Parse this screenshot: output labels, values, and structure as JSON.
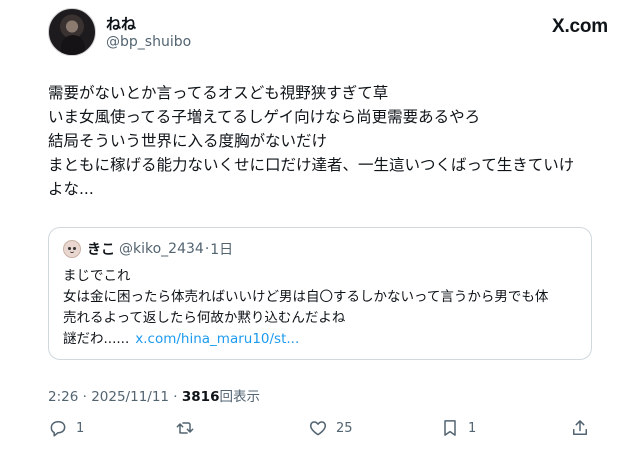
{
  "author": {
    "display_name": "ねね",
    "handle": "@bp_shuibo"
  },
  "brand": {
    "logo_text": "X.com"
  },
  "tweet": {
    "lines": [
      "需要がないとか言ってるオスども視野狭すぎて草",
      "いま女風使ってる子増えてるしゲイ向けなら尚更需要あるやろ",
      "結局そういう世界に入る度胸がないだけ",
      "まともに稼げる能力ないくせに口だけ達者、一生這いつくばって生きていけ",
      "よな..."
    ]
  },
  "quoted": {
    "name": "きこ",
    "handle": "@kiko_2434",
    "separator": "·",
    "time": "1日",
    "lines": [
      "まじでこれ",
      "女は金に困ったら体売ればいいけど男は自〇するしかないって言うから男でも体",
      "売れるよって返したら何故か黙り込むんだよね"
    ],
    "last_line": "謎だわ......",
    "link": "x.com/hina_maru10/st..."
  },
  "meta": {
    "time": "2:26",
    "dot": " · ",
    "date": "2025/11/11",
    "views_count": "3816",
    "views_label": "回表示"
  },
  "actions": {
    "reply_count": "1",
    "like_count": "25",
    "bookmark_count": "1"
  },
  "icons": {
    "reply": "reply-icon",
    "retweet": "retweet-icon",
    "like": "heart-icon",
    "bookmark": "bookmark-icon",
    "share": "share-icon"
  },
  "colors": {
    "link": "#1d9bf0",
    "muted": "#536471",
    "text": "#0f1419",
    "border": "#cfd9de"
  }
}
